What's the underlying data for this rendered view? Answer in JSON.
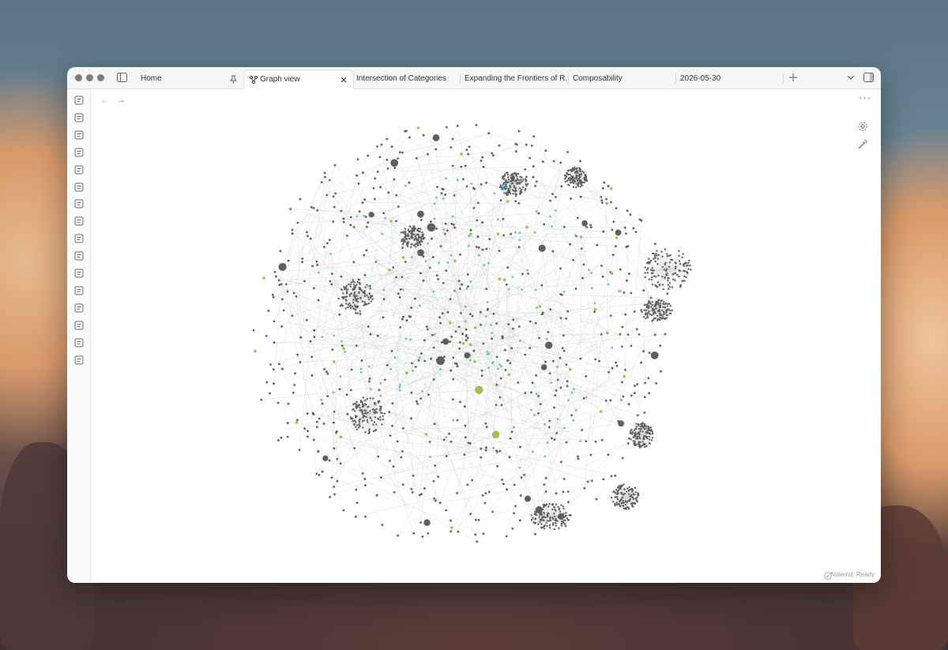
{
  "window": {
    "tabs": [
      {
        "label": "Home",
        "pinned": true
      },
      {
        "label": "Graph view",
        "active": true
      },
      {
        "label": "Intersection of Categories"
      },
      {
        "label": "Expanding the Frontiers of R..."
      },
      {
        "label": "Composability"
      },
      {
        "label": "2026-05-30"
      }
    ]
  },
  "ribbon": {
    "icons": [
      "tag-list-icon",
      "file-icon",
      "graph-icon",
      "blocks-icon",
      "copy-icon",
      "terminal-icon",
      "calendar-icon",
      "import-icon",
      "calendar-week-icon",
      "magic-wand-icon",
      "pen-icon",
      "table-icon",
      "slides-icon",
      "search-icon",
      "shapes-icon",
      "book-icon"
    ]
  },
  "graph": {
    "node_colors": {
      "default": "#5f5f5f",
      "attachment": "#5ec4cf",
      "tag": "#a3c14a"
    },
    "edge_color": "#d4d4d4"
  },
  "status": {
    "text": "Notemd: Ready"
  }
}
